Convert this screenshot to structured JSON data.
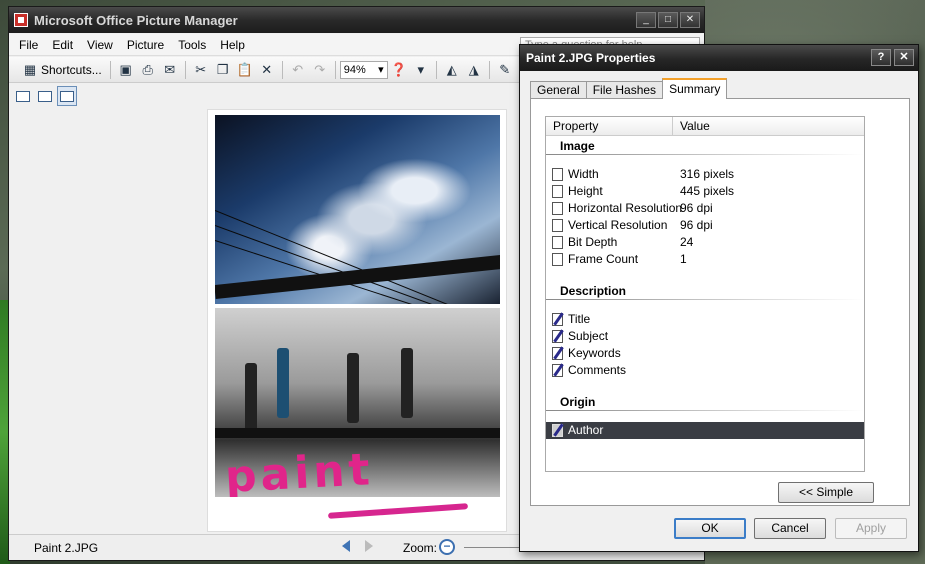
{
  "main_window": {
    "title": "Microsoft Office Picture Manager",
    "menu": [
      "File",
      "Edit",
      "View",
      "Picture",
      "Tools",
      "Help"
    ],
    "ask_placeholder": "Type a question for help",
    "toolbar": {
      "shortcuts_label": "Shortcuts...",
      "zoom_value": "94%",
      "edit_label": "Ed"
    },
    "status": {
      "filename": "Paint 2.JPG",
      "zoom_label": "Zoom:"
    },
    "image_caption": "paint"
  },
  "dialog": {
    "title": "Paint 2.JPG Properties",
    "tabs": [
      "General",
      "File Hashes",
      "Summary"
    ],
    "active_tab": "Summary",
    "columns": {
      "property": "Property",
      "value": "Value"
    },
    "sections": {
      "image": {
        "heading": "Image",
        "rows": [
          {
            "label": "Width",
            "value": "316 pixels"
          },
          {
            "label": "Height",
            "value": "445 pixels"
          },
          {
            "label": "Horizontal Resolution",
            "value": "96 dpi"
          },
          {
            "label": "Vertical Resolution",
            "value": "96 dpi"
          },
          {
            "label": "Bit Depth",
            "value": "24"
          },
          {
            "label": "Frame Count",
            "value": "1"
          }
        ]
      },
      "description": {
        "heading": "Description",
        "rows": [
          {
            "label": "Title"
          },
          {
            "label": "Subject"
          },
          {
            "label": "Keywords"
          },
          {
            "label": "Comments"
          }
        ]
      },
      "origin": {
        "heading": "Origin",
        "rows": [
          {
            "label": "Author",
            "selected": true
          }
        ]
      }
    },
    "simple_button": "<< Simple",
    "buttons": {
      "ok": "OK",
      "cancel": "Cancel",
      "apply": "Apply"
    }
  },
  "colors": {
    "title_bar": "#262626",
    "selection": "#3a3d44",
    "active_tab_accent": "#f4a12a",
    "default_button_border": "#3b7dc8"
  }
}
